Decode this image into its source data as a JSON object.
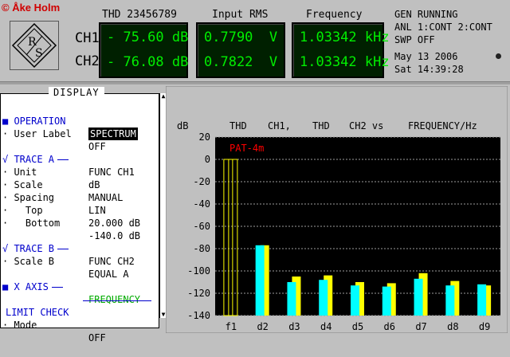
{
  "credit": "© Åke Holm",
  "header": {
    "ch1_label": "CH1",
    "ch2_label": "CH2",
    "columns": [
      {
        "title": "THD 23456789",
        "ch1": "- 75.60 dB",
        "ch2": "- 76.08 dB"
      },
      {
        "title": "Input RMS",
        "ch1": "0.7790  V",
        "ch2": "0.7822  V"
      },
      {
        "title": "Frequency",
        "ch1": "1.03342 kHz",
        "ch2": "1.03342 kHz"
      }
    ],
    "status": {
      "gen": "GEN RUNNING",
      "anl": "ANL 1:CONT 2:CONT",
      "swp": "SWP OFF",
      "date": "May 13 2006",
      "time": "Sat 14:39:28"
    }
  },
  "panel": {
    "title": "DISPLAY",
    "operation_label": "OPERATION",
    "operation_value": "SPECTRUM",
    "user_label": "User Label",
    "user_label_value": "OFF",
    "trace_a_label": "TRACE A",
    "trace_a_value": "FUNC CH1",
    "unit_label": "Unit",
    "unit_value": "dB",
    "scale_label": "Scale",
    "scale_value": "MANUAL",
    "spacing_label": "Spacing",
    "spacing_value": "LIN",
    "top_label": "Top",
    "top_value": "20.000 dB",
    "bottom_label": "Bottom",
    "bottom_value": "-140.0 dB",
    "trace_b_label": "TRACE B",
    "trace_b_value": "FUNC CH2",
    "scale_b_label": "Scale B",
    "scale_b_value": "EQUAL A",
    "x_axis_label": "X AXIS",
    "x_axis_value": "FREQUENCY",
    "limit_label": "LIMIT CHECK",
    "mode_label": "Mode",
    "mode_value": "OFF"
  },
  "chart_data": {
    "type": "bar",
    "header": [
      "dB",
      "THD",
      "CH1,",
      "THD",
      "CH2 vs",
      "FREQUENCY/Hz"
    ],
    "annotation": "PAT-4m",
    "categories": [
      "f1",
      "d2",
      "d3",
      "d4",
      "d5",
      "d6",
      "d7",
      "d8",
      "d9"
    ],
    "series": [
      {
        "name": "CH1",
        "values": [
          0,
          -77,
          -110,
          -108,
          -113,
          -114,
          -107,
          -113,
          -112
        ]
      },
      {
        "name": "CH2",
        "values": [
          0,
          -77,
          -105,
          -104,
          -110,
          -111,
          -102,
          -109,
          -113
        ]
      }
    ],
    "colors": {
      "ch1": "#00ffff",
      "ch2": "#ffff00",
      "background": "#000000",
      "grid": "#9b9b9b",
      "annotation": "#ff0000"
    },
    "ylim": [
      -140,
      20
    ],
    "yticks": [
      20,
      0,
      -20,
      -40,
      -60,
      -80,
      -100,
      -120,
      -140
    ],
    "grid": true
  }
}
